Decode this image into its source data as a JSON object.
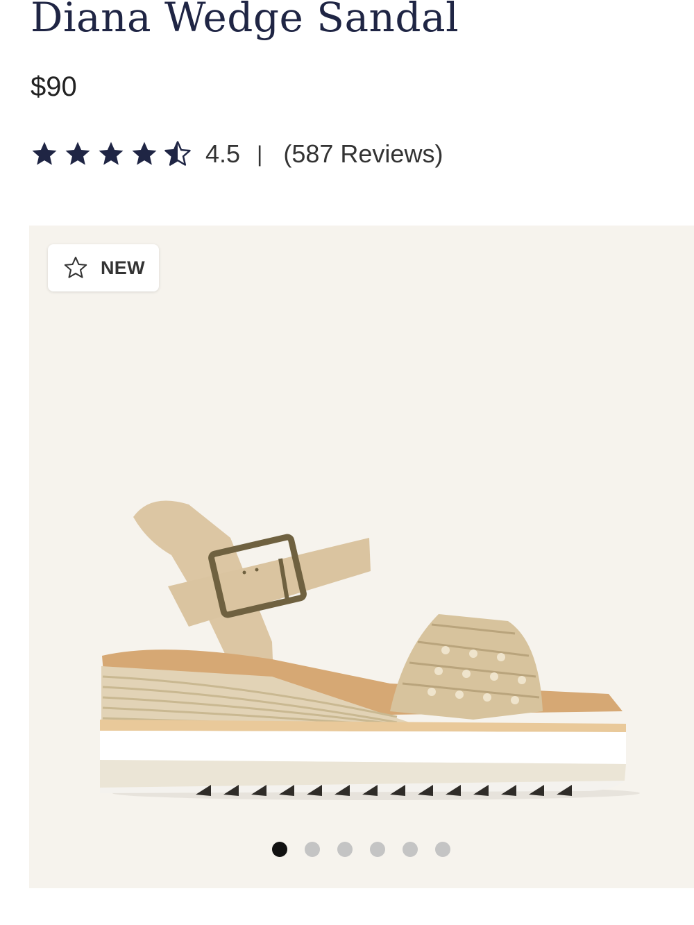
{
  "product": {
    "title": "Diana Wedge Sandal",
    "price": "$90"
  },
  "rating": {
    "value": "4.5",
    "stars_filled": 4.5,
    "stars_total": 5,
    "separator": "|",
    "reviews_label": "(587 Reviews)"
  },
  "gallery": {
    "badge": {
      "label": "NEW",
      "icon": "star-outline-icon"
    },
    "image_subject": "wedge-sandal",
    "dots_count": 6,
    "active_index": 0
  },
  "colors": {
    "title": "#1f2544",
    "gallery_background": "#f6f3ed",
    "dot_active": "#111111",
    "dot_inactive": "#c4c4c4"
  }
}
